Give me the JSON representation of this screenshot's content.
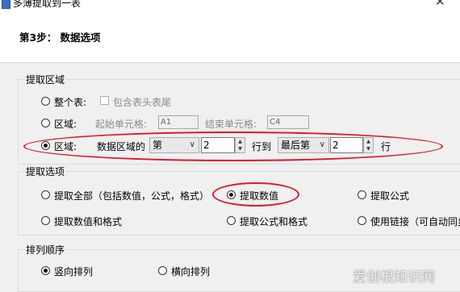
{
  "window": {
    "title": "多薄提取到一表"
  },
  "header": {
    "step_title": "第3步： 数据选项"
  },
  "extract_region": {
    "legend": "提取区域",
    "whole_table": {
      "label": "整个表:",
      "include_header_label": "包含表头表尾"
    },
    "region_cells": {
      "label": "区域:",
      "start_label": "起始单元格:",
      "start_value": "A1",
      "end_label": "结束单元格:",
      "end_value": "C4"
    },
    "region_rows": {
      "label": "区域:",
      "data_region_label": "数据区域的",
      "from_select": "第",
      "from_value": "2",
      "to_label": "行到",
      "to_select": "最后第",
      "to_value": "2",
      "row_suffix": "行"
    }
  },
  "extract_options": {
    "legend": "提取选项",
    "options": [
      {
        "label": "提取全部（包括数值，公式，格式）",
        "checked": false
      },
      {
        "label": "提取数值",
        "checked": true
      },
      {
        "label": "提取公式",
        "checked": false
      },
      {
        "label": "提取数值和格式",
        "checked": false
      },
      {
        "label": "提取公式和格式",
        "checked": false
      },
      {
        "label": "使用链接（可自动同步",
        "checked": false
      }
    ]
  },
  "sort_order": {
    "legend": "排列顺序",
    "options": [
      {
        "label": "竖向排列",
        "checked": true
      },
      {
        "label": "横向排列",
        "checked": false
      }
    ]
  },
  "watermark": "爱创根知识网",
  "colors": {
    "annotation": "#e0162b",
    "header_bg": "#ffffff",
    "dialog_bg": "#f0f0f0"
  },
  "icons": {
    "app": "app-icon",
    "close": "close-icon"
  }
}
